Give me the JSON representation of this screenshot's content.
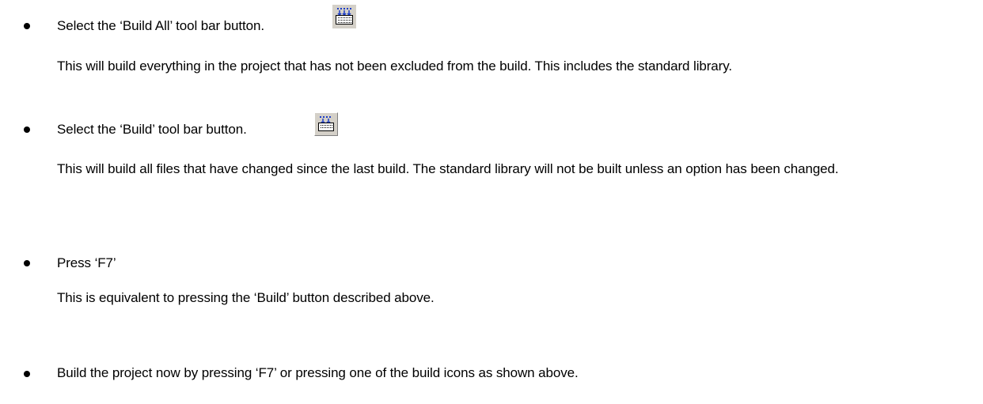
{
  "items": [
    {
      "label": "Select the ‘Build All’ tool bar button.",
      "icon": "build-all-icon",
      "description": "This will build everything in the project that has not been excluded from the build. This includes the standard library."
    },
    {
      "label": "Select the ‘Build’ tool bar button.",
      "icon": "build-icon",
      "description": "This will build all files that have changed since the last build. The standard library will not be built unless an option has been changed."
    },
    {
      "label": "Press ‘F7’",
      "description": "This is equivalent to pressing the ‘Build’ button described above."
    },
    {
      "label": "Build the project now by pressing ‘F7’ or pressing one of the build icons as shown above."
    }
  ],
  "colors": {
    "text": "#000000",
    "icon_face": "#d4d0c8",
    "icon_blue": "#1a3cc8"
  }
}
